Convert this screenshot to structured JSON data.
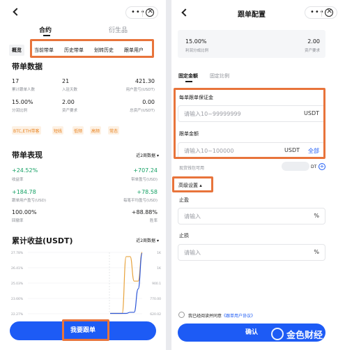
{
  "left": {
    "main_tabs": [
      "合约",
      "衍生品"
    ],
    "sub_tabs": [
      "概览",
      "当前带单",
      "历史带单",
      "划转历史",
      "跟单用户"
    ],
    "section_data_title": "带单数据",
    "stats": [
      {
        "value": "17",
        "label": "累计跟单人数"
      },
      {
        "value": "21",
        "label": "入驻天数"
      },
      {
        "value": "421.30",
        "label": "用户盈亏(USDT)"
      },
      {
        "value": "15.00%",
        "label": "分润比例"
      },
      {
        "value": "2.00",
        "label": "资产要求"
      },
      {
        "value": "0.00",
        "label": "总资产(USDT)"
      }
    ],
    "tags": [
      "BTC,ETH带客",
      "短线",
      "低频",
      "高频",
      "常态"
    ],
    "section_perf_title": "带单表现",
    "perf_period": "近2周数据",
    "perf": [
      {
        "value": "+24.52%",
        "label": "收益率"
      },
      {
        "value": "+707.24",
        "label": "带单盈亏(USD)"
      },
      {
        "value": "+184.78",
        "label": "跟单用户盈亏(USD)"
      },
      {
        "value": "+78.58",
        "label": "每笔平均盈亏(USD)"
      },
      {
        "value": "100.00%",
        "label": "回撤率"
      },
      {
        "value": "+88.88%",
        "label": "胜率"
      }
    ],
    "section_cum_title": "累计收益(USDT)",
    "cum_period": "近2周数据",
    "cta": "我要跟单"
  },
  "chart_data": {
    "type": "line",
    "title": "累计收益(USDT)",
    "y_left_ticks": [
      "27.78%",
      "26.41%",
      "25.03%",
      "23.66%",
      "22.27%"
    ],
    "y_right_ticks": [
      "1K",
      "1K",
      "900.1",
      "770.00",
      "620.02"
    ],
    "series": [
      {
        "color": "#e8a33c",
        "values": [
          22.3,
          22.3,
          22.3,
          22.3,
          27.4,
          27.4,
          25.2,
          25.2,
          27.8
        ]
      },
      {
        "color": "#2c56d8",
        "values": [
          22.3,
          22.3,
          22.3,
          22.3,
          22.3,
          22.4,
          22.4,
          24.5,
          27.7
        ]
      }
    ],
    "grid": true
  },
  "right": {
    "title": "跟单配置",
    "summary": [
      {
        "value": "15.00%",
        "label": "利润分成比例"
      },
      {
        "value": "2.00",
        "label": "资产要求"
      }
    ],
    "mode_tabs": [
      "固定金额",
      "固定比例"
    ],
    "margin_label": "每单跟单保证金",
    "margin_placeholder": "请输入10~99999999",
    "margin_unit": "USDT",
    "amount_label": "跟单金额",
    "amount_placeholder": "请输入10~100000",
    "amount_unit": "USDT",
    "amount_all": "全部",
    "wallet_label": "现货钱包可用",
    "wallet_value": "DT",
    "advanced_label": "高级设置",
    "tp_label": "止盈",
    "tp_placeholder": "请输入",
    "sl_label": "止损",
    "sl_placeholder": "请输入",
    "percent": "%",
    "agree_text": "我已经阅读并同意",
    "agree_link": "《跟单用户协议》",
    "confirm": "确认",
    "watermark": "金色财经"
  }
}
